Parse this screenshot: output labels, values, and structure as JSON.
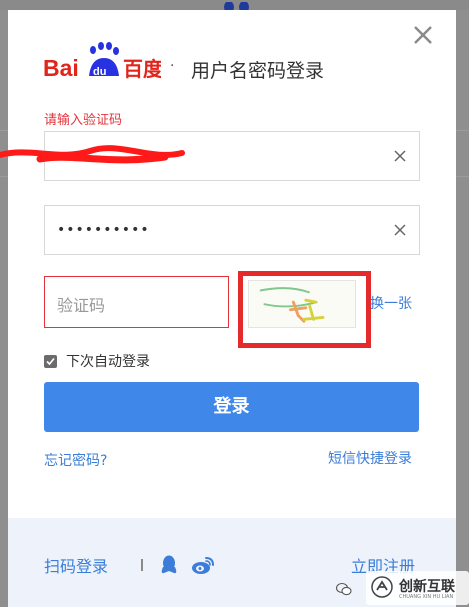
{
  "header": {
    "logo_text": "Bai百度",
    "logo_badge": "du",
    "separator": "·",
    "title": "用户名密码登录"
  },
  "form": {
    "error_message": "请输入验证码",
    "password_value": "••••••••••",
    "captcha_placeholder": "验证码",
    "captcha_refresh": "换一张",
    "remember_label": "下次自动登录",
    "login_button": "登录",
    "forgot_password": "忘记密码?",
    "sms_login": "短信快捷登录"
  },
  "footer": {
    "qr_login": "扫码登录",
    "register": "立即注册"
  },
  "watermark": {
    "text": "创新互联",
    "sub": "CHUANG XIN HU LIAN"
  },
  "colors": {
    "accent": "#3f88ea",
    "error": "#e5333b",
    "link": "#3b7dd8"
  }
}
